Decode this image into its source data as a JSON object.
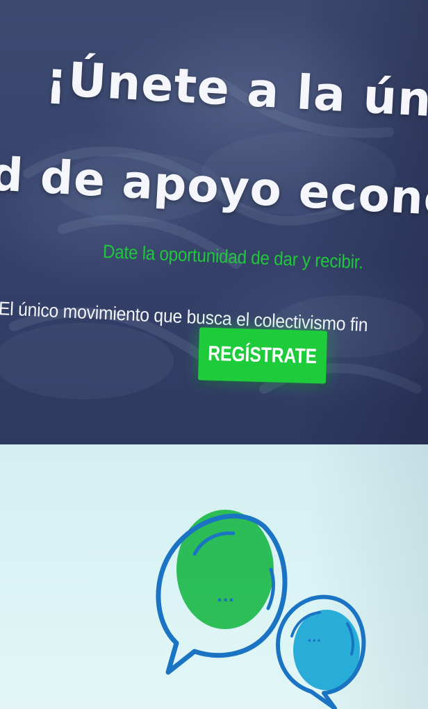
{
  "hero": {
    "headline_line1": "¡Únete a la única",
    "headline_line2": "d de apoyo económ",
    "tagline": "Date la oportunidad de dar y recibir.",
    "subtitle": "El único movimiento que busca el colectivismo fin",
    "cta_label": "REGÍSTRATE"
  },
  "feature": {
    "illustration_icon": "chat-bubbles-icon",
    "bubble_left_text": "...",
    "bubble_right_text": "..."
  },
  "colors": {
    "hero_background": "#36426a",
    "accent_green": "#1ecb3a",
    "tagline_green": "#1ec83a",
    "lower_background": "#d6f1f3",
    "icon_blue": "#1b73c4",
    "icon_cyan": "#1fa9d6"
  }
}
